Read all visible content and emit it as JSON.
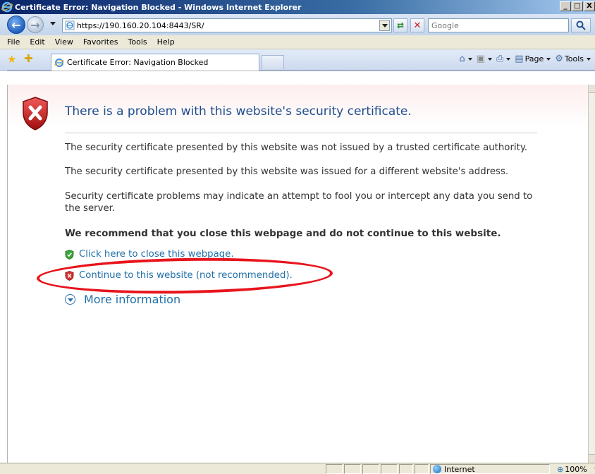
{
  "window": {
    "title": "Certificate Error: Navigation Blocked - Windows Internet Explorer",
    "minimize": "_",
    "maximize": "□",
    "close": "X"
  },
  "address_bar": {
    "url": "https://190.160.20.104:8443/SR/"
  },
  "search": {
    "placeholder": "Google"
  },
  "menu": {
    "items": [
      "File",
      "Edit",
      "View",
      "Favorites",
      "Tools",
      "Help"
    ]
  },
  "tab": {
    "label": "Certificate Error: Navigation Blocked"
  },
  "command_bar": {
    "page_label": "Page",
    "tools_label": "Tools"
  },
  "content": {
    "heading": "There is a problem with this website's security certificate.",
    "para1": "The security certificate presented by this website was not issued by a trusted certificate authority.",
    "para2": "The security certificate presented by this website was issued for a different website's address.",
    "para3": "Security certificate problems may indicate an attempt to fool you or intercept any data you send to the server.",
    "recommend": "We recommend that you close this webpage and do not continue to this website.",
    "close_link": "Click here to close this webpage.",
    "continue_link": "Continue to this website (not recommended).",
    "more_info": "More information"
  },
  "status_bar": {
    "zone": "Internet",
    "zoom": "100%"
  },
  "colors": {
    "heading": "#1f4e8c",
    "link": "#1f6fa8",
    "annotation": "#e8141c"
  }
}
